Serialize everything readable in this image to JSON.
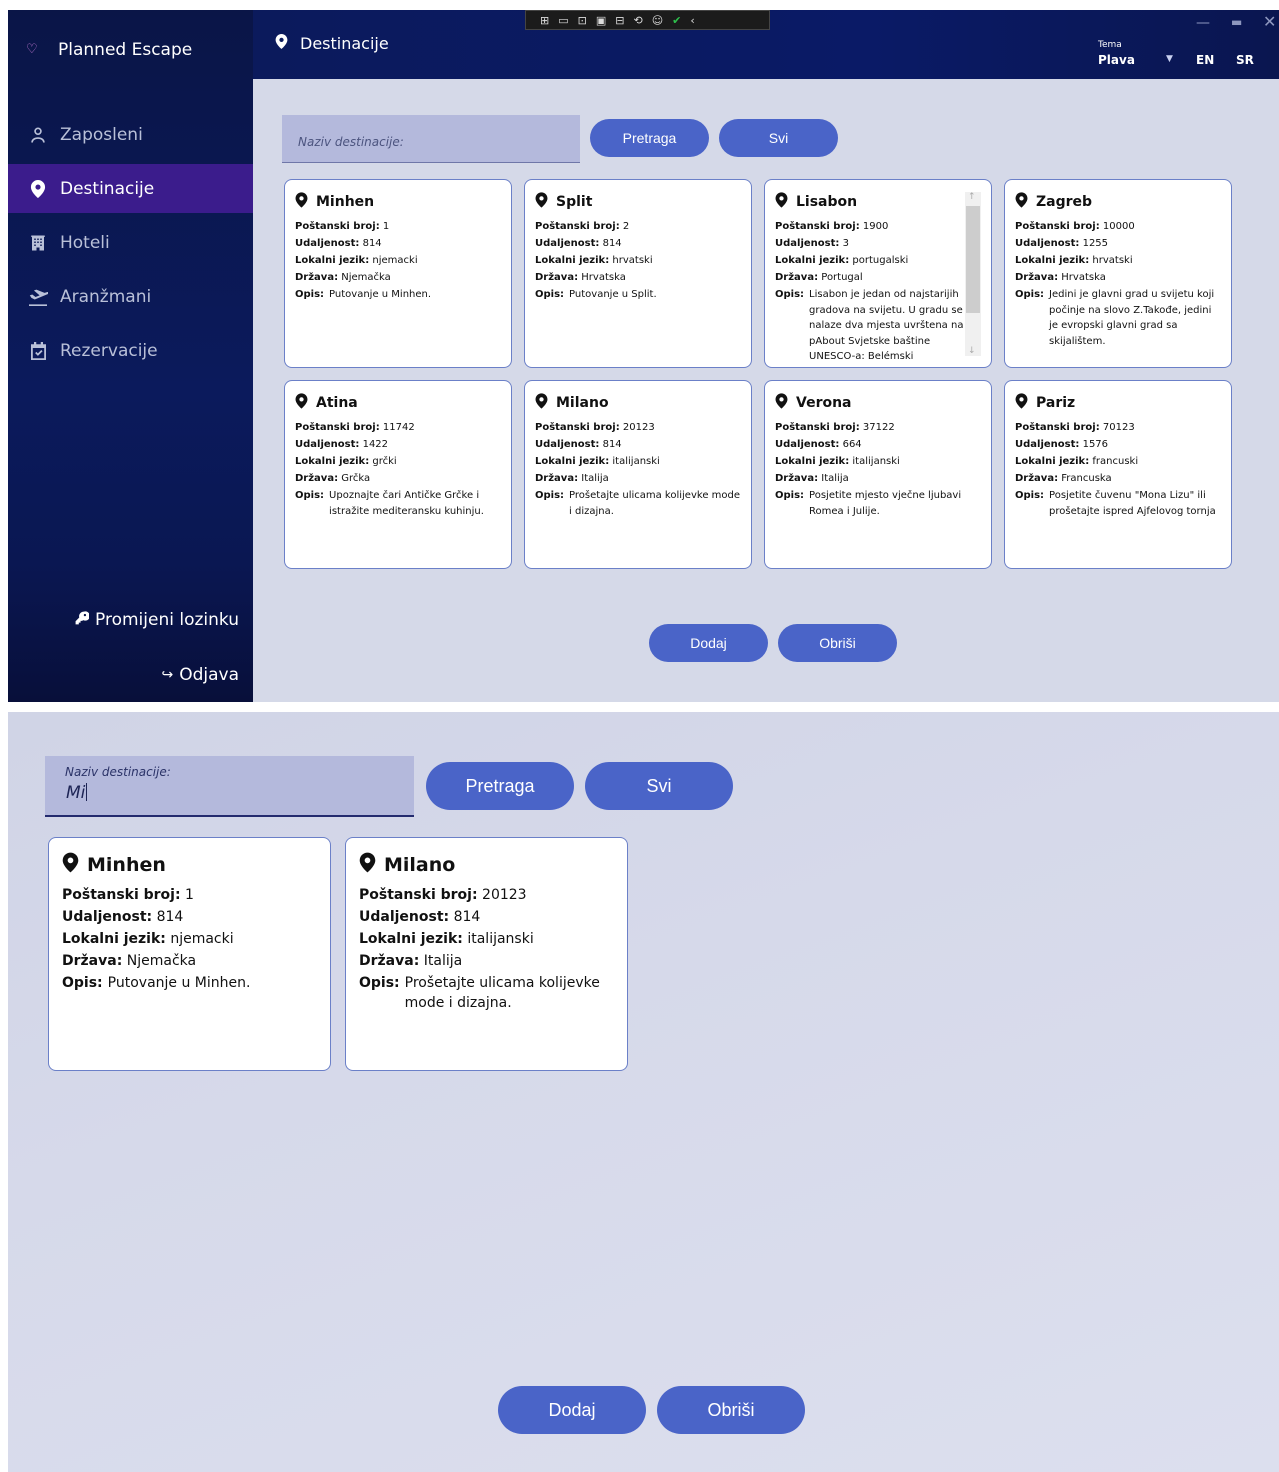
{
  "app": {
    "title": "Planned Escape",
    "page_title": "Destinacije",
    "theme_label": "Tema",
    "theme_value": "Plava",
    "lang_en": "EN",
    "lang_sr": "SR"
  },
  "sidebar": {
    "items": [
      {
        "label": "Zaposleni",
        "icon": "user-icon",
        "active": false
      },
      {
        "label": "Destinacije",
        "icon": "map-pin-icon",
        "active": true
      },
      {
        "label": "Hoteli",
        "icon": "hotel-icon",
        "active": false
      },
      {
        "label": "Aranžmani",
        "icon": "plane-icon",
        "active": false
      },
      {
        "label": "Rezervacije",
        "icon": "calendar-check-icon",
        "active": false
      }
    ],
    "change_password": "Promijeni lozinku",
    "logout": "Odjava"
  },
  "search": {
    "placeholder": "Naziv destinacije:",
    "label": "Naziv destinacije:",
    "value": "Mi",
    "search_button": "Pretraga",
    "all_button": "Svi"
  },
  "labels": {
    "postal": "Poštanski broj:",
    "distance": "Udaljenost:",
    "language": "Lokalni jezik:",
    "country": "Država:",
    "description": "Opis:"
  },
  "destinations": [
    {
      "name": "Minhen",
      "postal": "1",
      "distance": "814",
      "language": "njemacki",
      "country": "Njemačka",
      "description": "Putovanje u Minhen."
    },
    {
      "name": "Split",
      "postal": "2",
      "distance": "814",
      "language": "hrvatski",
      "country": "Hrvatska",
      "description": "Putovanje u Split."
    },
    {
      "name": "Lisabon",
      "postal": "1900",
      "distance": "3",
      "language": "portugalski",
      "country": "Portugal",
      "description": "Lisabon je jedan od najstarijih gradova na svijetu. U gradu se nalaze dva mjesta uvrštena na pAbout Svjetske baštine UNESCO-a: Belémski"
    },
    {
      "name": "Zagreb",
      "postal": "10000",
      "distance": "1255",
      "language": "hrvatski",
      "country": "Hrvatska",
      "description": "Jedini je glavni grad u svijetu koji počinje na slovo Z.Takođe, jedini je evropski glavni grad sa skijalištem."
    },
    {
      "name": "Atina",
      "postal": "11742",
      "distance": "1422",
      "language": "grčki",
      "country": "Grčka",
      "description": "Upoznajte čari Antičke Grčke i istražite mediteransku kuhinju."
    },
    {
      "name": "Milano",
      "postal": "20123",
      "distance": "814",
      "language": "italijanski",
      "country": "Italija",
      "description": "Prošetajte ulicama kolijevke mode i dizajna."
    },
    {
      "name": "Verona",
      "postal": "37122",
      "distance": "664",
      "language": "italijanski",
      "country": "Italija",
      "description": "Posjetite mjesto vječne ljubavi Romea i Julije."
    },
    {
      "name": "Pariz",
      "postal": "70123",
      "distance": "1576",
      "language": "francuski",
      "country": "Francuska",
      "description": "Posjetite čuvenu \"Mona Lizu\" ili prošetajte ispred Ajfelovog tornja"
    }
  ],
  "filtered": [
    {
      "name": "Minhen",
      "postal": "1",
      "distance": "814",
      "language": "njemacki",
      "country": "Njemačka",
      "description": "Putovanje u Minhen."
    },
    {
      "name": "Milano",
      "postal": "20123",
      "distance": "814",
      "language": "italijanski",
      "country": "Italija",
      "description": "Prošetajte ulicama kolijevke mode i dizajna."
    }
  ],
  "actions": {
    "add": "Dodaj",
    "delete": "Obriši"
  },
  "colors": {
    "accent": "#4a64c8",
    "sidebar_bg": "#0b1a5c",
    "active_item": "#3b1c8c",
    "content_bg": "#d5d9e8"
  }
}
